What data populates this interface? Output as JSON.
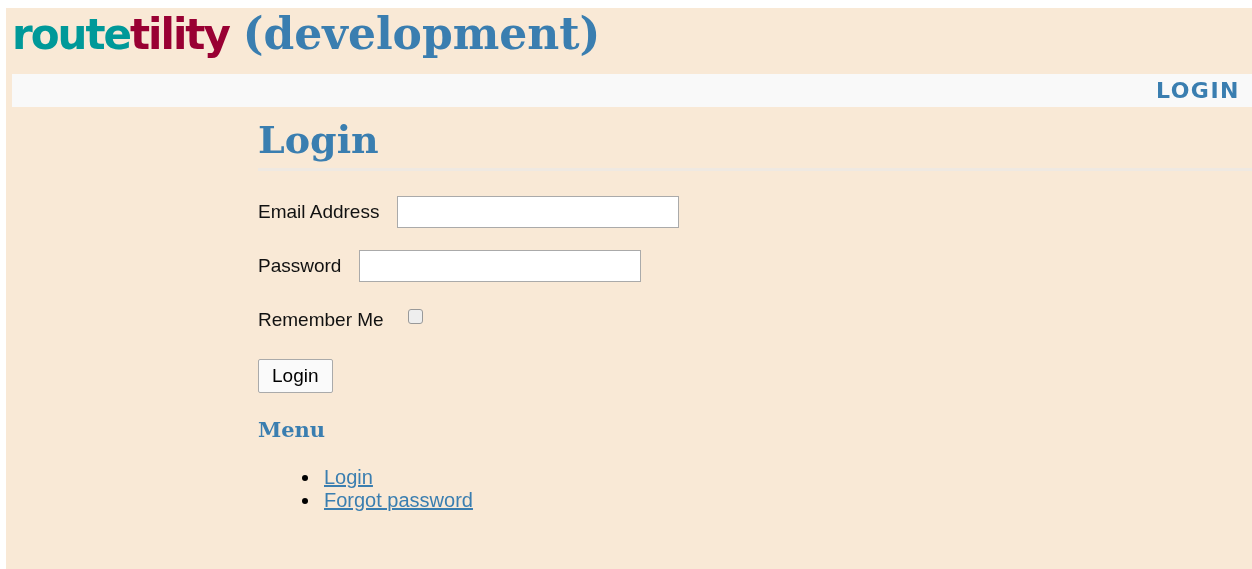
{
  "header": {
    "logo": [
      {
        "text": "route",
        "color": "#009999"
      },
      {
        "text": "tility",
        "color": "#990033"
      }
    ],
    "subtitle": "(development)"
  },
  "nav": {
    "items": [
      {
        "label": "LOGIN"
      }
    ]
  },
  "page": {
    "title": "Login",
    "fields": [
      {
        "kind": "text",
        "label": "Email Address"
      },
      {
        "kind": "password",
        "label": "Password"
      },
      {
        "kind": "checkbox",
        "label": "Remember Me",
        "checked": false
      }
    ],
    "submit": "Login",
    "menu": {
      "title": "Menu",
      "items": [
        {
          "label": "Login"
        },
        {
          "label": "Forgot password"
        }
      ]
    }
  }
}
